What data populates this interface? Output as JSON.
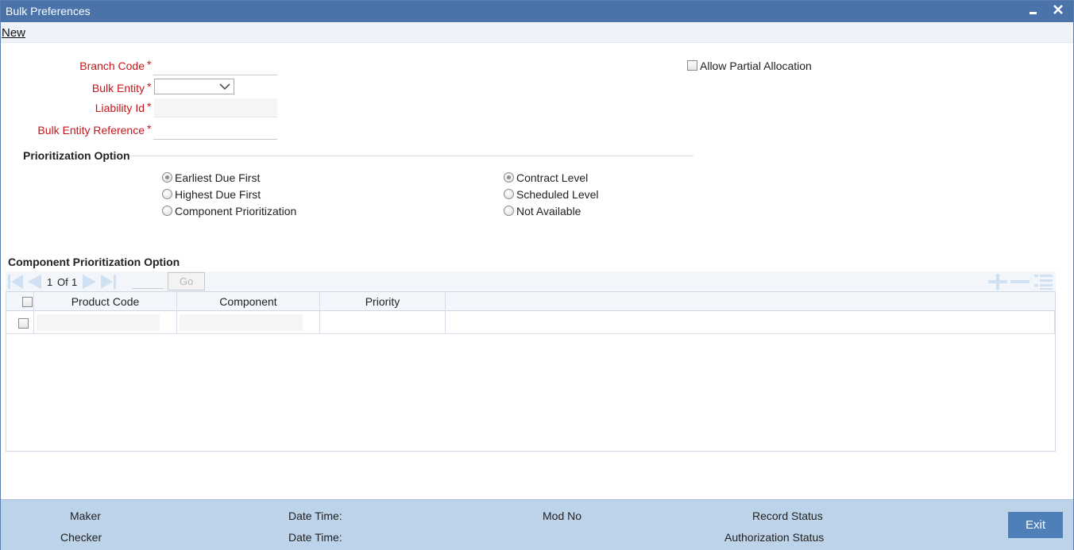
{
  "window": {
    "title": "Bulk Preferences",
    "minimize_icon": "minimize-icon",
    "close_icon": "close-icon"
  },
  "menu": {
    "new_label": "New"
  },
  "form": {
    "branch_code_label": "Branch Code",
    "bulk_entity_label": "Bulk Entity",
    "liability_id_label": "Liability Id",
    "bulk_entity_reference_label": "Bulk Entity Reference",
    "required_mark": "*",
    "allow_partial_allocation_label": "Allow Partial Allocation",
    "allow_partial_allocation_checked": false
  },
  "prioritization": {
    "section_title": "Prioritization Option",
    "group1": [
      {
        "label": "Earliest Due First",
        "selected": true
      },
      {
        "label": "Highest Due First",
        "selected": false
      },
      {
        "label": "Component Prioritization",
        "selected": false
      }
    ],
    "group2": [
      {
        "label": "Contract Level",
        "selected": true
      },
      {
        "label": "Scheduled Level",
        "selected": false
      },
      {
        "label": "Not Available",
        "selected": false
      }
    ]
  },
  "component_grid": {
    "section_title": "Component Prioritization Option",
    "pager": {
      "current": "1",
      "of_label": "Of",
      "total": "1",
      "go_label": "Go"
    },
    "columns": [
      "Product Code",
      "Component",
      "Priority"
    ],
    "rows": [
      {
        "product_code": "",
        "component": "",
        "priority": ""
      }
    ]
  },
  "footer": {
    "maker_label": "Maker",
    "checker_label": "Checker",
    "date_time_label_1": "Date Time:",
    "date_time_label_2": "Date Time:",
    "mod_no_label": "Mod No",
    "record_status_label": "Record Status",
    "authorization_status_label": "Authorization Status",
    "exit_label": "Exit"
  },
  "colors": {
    "titlebar": "#4a73aa",
    "required_label": "#c4161c",
    "footer": "#bdd3e9",
    "exit_button": "#4f7fb8"
  }
}
